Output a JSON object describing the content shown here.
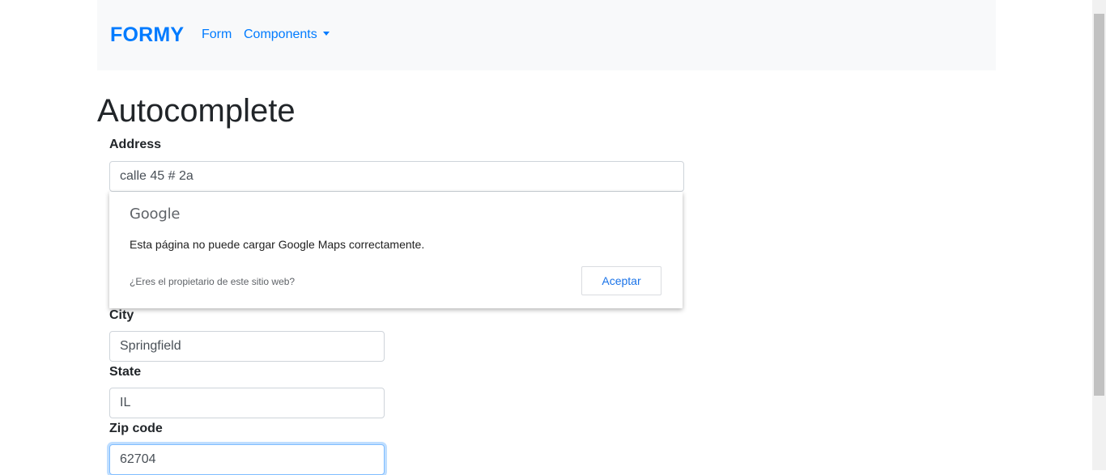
{
  "navbar": {
    "brand": "FORMY",
    "links": [
      {
        "label": "Form"
      },
      {
        "label": "Components"
      }
    ]
  },
  "page": {
    "title": "Autocomplete"
  },
  "form": {
    "address": {
      "label": "Address",
      "value": "calle 45 # 2a"
    },
    "city": {
      "label": "City",
      "value": "Springfield"
    },
    "state": {
      "label": "State",
      "value": "IL"
    },
    "zip": {
      "label": "Zip code",
      "value": "62704"
    }
  },
  "maps_error": {
    "logo_text": "Google",
    "message": "Esta página no puede cargar Google Maps correctamente.",
    "owner_link": "¿Eres el propietario de este sitio web?",
    "accept_label": "Aceptar"
  },
  "colors": {
    "accent": "#007bff",
    "navbar_bg": "#f8f9fa",
    "google_button": "#1a73e8"
  }
}
